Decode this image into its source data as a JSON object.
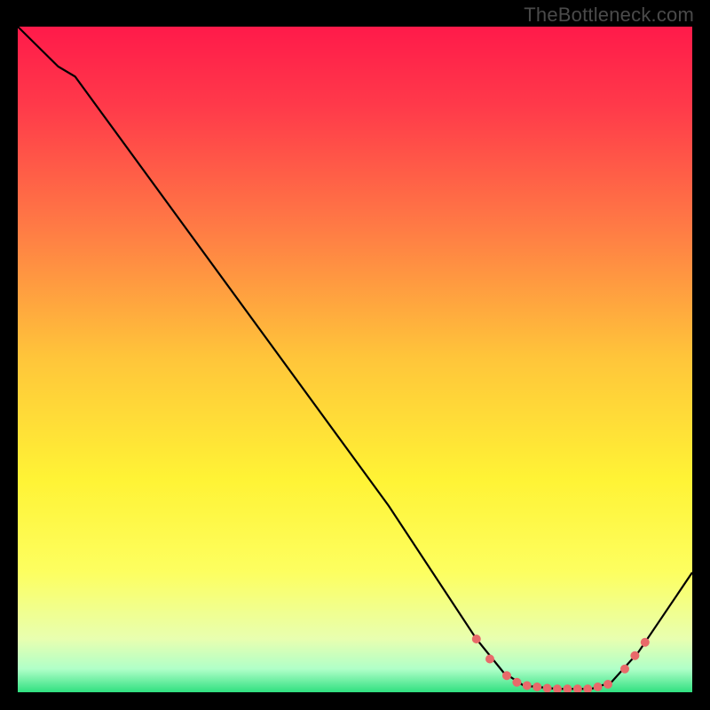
{
  "attribution": "TheBottleneck.com",
  "chart_data": {
    "type": "line",
    "title": "",
    "xlabel": "",
    "ylabel": "",
    "xlim": [
      0,
      100
    ],
    "ylim": [
      0,
      100
    ],
    "background_gradient": {
      "stops": [
        {
          "offset": 0.0,
          "color": "#ff1a4a"
        },
        {
          "offset": 0.12,
          "color": "#ff3a4a"
        },
        {
          "offset": 0.3,
          "color": "#ff7a45"
        },
        {
          "offset": 0.5,
          "color": "#ffc63a"
        },
        {
          "offset": 0.68,
          "color": "#fff335"
        },
        {
          "offset": 0.82,
          "color": "#fdff60"
        },
        {
          "offset": 0.92,
          "color": "#e8ffb0"
        },
        {
          "offset": 0.965,
          "color": "#b0ffc8"
        },
        {
          "offset": 1.0,
          "color": "#30e080"
        }
      ]
    },
    "series": [
      {
        "name": "bottleneck-curve",
        "color": "#000000",
        "points": [
          {
            "x": 0.0,
            "y": 100.0
          },
          {
            "x": 6.0,
            "y": 94.0
          },
          {
            "x": 8.5,
            "y": 92.5
          },
          {
            "x": 55.0,
            "y": 28.0
          },
          {
            "x": 68.0,
            "y": 8.0
          },
          {
            "x": 72.0,
            "y": 3.0
          },
          {
            "x": 75.0,
            "y": 1.0
          },
          {
            "x": 80.0,
            "y": 0.5
          },
          {
            "x": 85.0,
            "y": 0.5
          },
          {
            "x": 88.0,
            "y": 1.5
          },
          {
            "x": 92.0,
            "y": 6.0
          },
          {
            "x": 100.0,
            "y": 18.0
          }
        ]
      }
    ],
    "markers": {
      "color": "#e86a6a",
      "radius": 5,
      "points": [
        {
          "x": 68.0,
          "y": 8.0
        },
        {
          "x": 70.0,
          "y": 5.0
        },
        {
          "x": 72.5,
          "y": 2.5
        },
        {
          "x": 74.0,
          "y": 1.5
        },
        {
          "x": 75.5,
          "y": 1.0
        },
        {
          "x": 77.0,
          "y": 0.8
        },
        {
          "x": 78.5,
          "y": 0.6
        },
        {
          "x": 80.0,
          "y": 0.5
        },
        {
          "x": 81.5,
          "y": 0.5
        },
        {
          "x": 83.0,
          "y": 0.5
        },
        {
          "x": 84.5,
          "y": 0.5
        },
        {
          "x": 86.0,
          "y": 0.8
        },
        {
          "x": 87.5,
          "y": 1.2
        },
        {
          "x": 90.0,
          "y": 3.5
        },
        {
          "x": 91.5,
          "y": 5.5
        },
        {
          "x": 93.0,
          "y": 7.5
        }
      ]
    }
  }
}
